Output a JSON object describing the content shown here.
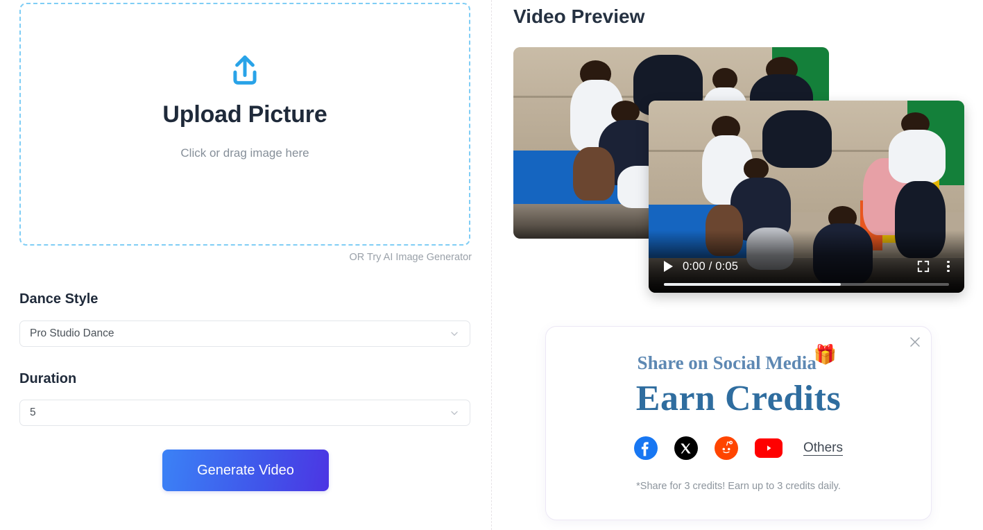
{
  "left": {
    "dropzone": {
      "icon": "upload-icon",
      "title": "Upload Picture",
      "subtitle": "Click or drag image here"
    },
    "or_try": {
      "prefix": "OR Try",
      "link_label": "AI Image Generator"
    },
    "dance_style": {
      "label": "Dance Style",
      "value": "Pro Studio Dance",
      "chevron": "chevron-down-icon"
    },
    "duration": {
      "label": "Duration",
      "value": "5",
      "chevron": "chevron-down-icon"
    },
    "generate_button": {
      "label": "Generate Video",
      "gradient_from": "#3b82f6",
      "gradient_to": "#4c35e3"
    }
  },
  "right": {
    "section_title": "Video Preview",
    "player": {
      "play_icon": "play-icon",
      "time": "0:00 / 0:05",
      "current_time": "0:00",
      "total_time": "0:05",
      "fullscreen_icon": "fullscreen-icon",
      "more_icon": "kebab-menu-icon",
      "progress_percent": 62
    },
    "share_card": {
      "close_icon": "close-icon",
      "heading": "Share on Social Media",
      "gift_emoji": "🎁",
      "subheading": "Earn Credits",
      "heading_color": "#5d88b3",
      "subheading_color": "#2f6d9f",
      "socials": [
        {
          "name": "facebook",
          "color": "#1877f2"
        },
        {
          "name": "x-twitter",
          "color": "#000000"
        },
        {
          "name": "reddit",
          "color": "#ff4500"
        },
        {
          "name": "youtube",
          "color": "#ff0000"
        }
      ],
      "others_label": "Others",
      "note": "*Share for 3 credits! Earn up to 3 credits daily."
    }
  }
}
